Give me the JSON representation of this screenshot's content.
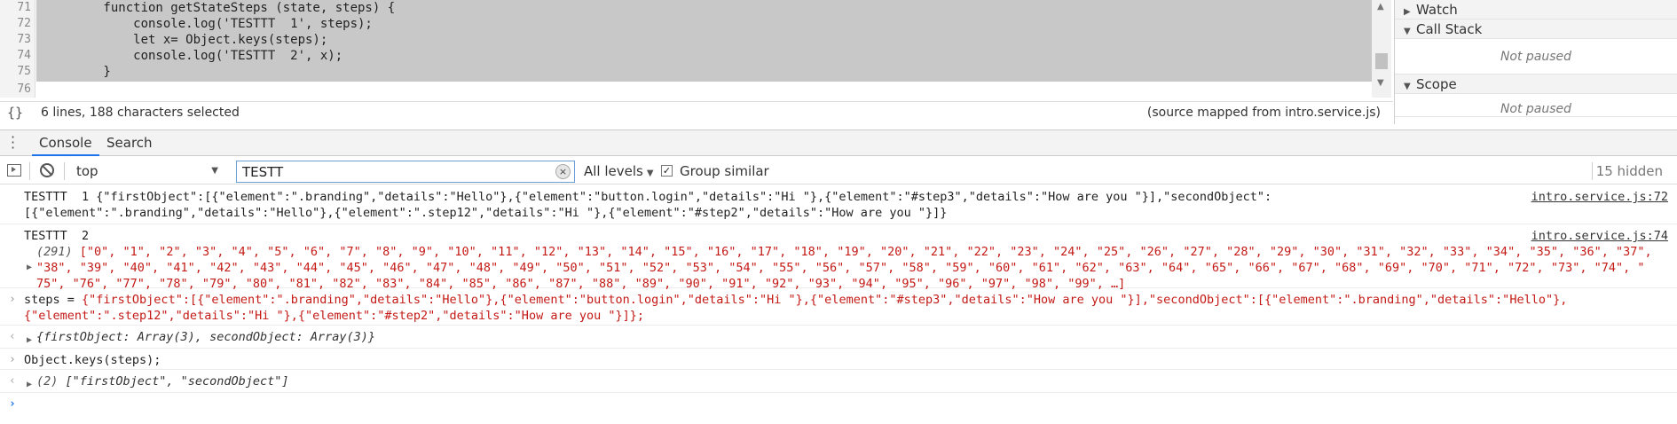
{
  "editor": {
    "lines": [
      {
        "num": "71",
        "text": "        function getStateSteps (state, steps) {"
      },
      {
        "num": "72",
        "text": "            console.log('TESTTT  1', steps);"
      },
      {
        "num": "73",
        "text": "            let x= Object.keys(steps);"
      },
      {
        "num": "74",
        "text": "            console.log('TESTTT  2', x);"
      },
      {
        "num": "75",
        "text": "        }"
      },
      {
        "num": "76",
        "text": ""
      }
    ],
    "status_selection": "6 lines, 188 characters selected",
    "status_source": "(source mapped from intro.service.js)",
    "format_icon": "{}"
  },
  "sidebar": {
    "sections": [
      {
        "label": "Watch",
        "expanded": false
      },
      {
        "label": "Call Stack",
        "expanded": true,
        "empty": "Not paused"
      },
      {
        "label": "Scope",
        "expanded": true,
        "empty": "Not paused"
      }
    ]
  },
  "drawer": {
    "tabs": [
      "Console",
      "Search"
    ],
    "active_tab": "Console"
  },
  "toolbar": {
    "context": "top",
    "filter_value": "TESTT",
    "levels": "All levels",
    "group_similar_label": "Group similar",
    "group_similar_checked": true,
    "hidden": "15 hidden"
  },
  "console": {
    "msg1": {
      "label": "TESTTT  1",
      "line1": " {\"firstObject\":[{\"element\":\".branding\",\"details\":\"Hello\"},{\"element\":\"button.login\",\"details\":\"Hi \"},{\"element\":\"#step3\",\"details\":\"How are you \"}],\"secondObject\":",
      "line2": "[{\"element\":\".branding\",\"details\":\"Hello\"},{\"element\":\".step12\",\"details\":\"Hi \"},{\"element\":\"#step2\",\"details\":\"How are you \"}]}",
      "source": "intro.service.js:72"
    },
    "msg2": {
      "label": "TESTTT  2",
      "source": "intro.service.js:74",
      "count": "(291)",
      "line1": "[\"0\", \"1\", \"2\", \"3\", \"4\", \"5\", \"6\", \"7\", \"8\", \"9\", \"10\", \"11\", \"12\", \"13\", \"14\", \"15\", \"16\", \"17\", \"18\", \"19\", \"20\", \"21\", \"22\", \"23\", \"24\", \"25\", \"26\", \"27\", \"28\", \"29\", \"30\", \"31\", \"32\", \"33\", \"34\", \"35\", \"36\", \"37\",",
      "line2": "\"38\", \"39\", \"40\", \"41\", \"42\", \"43\", \"44\", \"45\", \"46\", \"47\", \"48\", \"49\", \"50\", \"51\", \"52\", \"53\", \"54\", \"55\", \"56\", \"57\", \"58\", \"59\", \"60\", \"61\", \"62\", \"63\", \"64\", \"65\", \"66\", \"67\", \"68\", \"69\", \"70\", \"71\", \"72\", \"73\", \"74\", \"",
      "line3": "75\", \"76\", \"77\", \"78\", \"79\", \"80\", \"81\", \"82\", \"83\", \"84\", \"85\", \"86\", \"87\", \"88\", \"89\", \"90\", \"91\", \"92\", \"93\", \"94\", \"95\", \"96\", \"97\", \"98\", \"99\", …]"
    },
    "cmd1": {
      "line1_prefix": "steps = ",
      "line1": "{\"firstObject\":[{\"element\":\".branding\",\"details\":\"Hello\"},{\"element\":\"button.login\",\"details\":\"Hi \"},{\"element\":\"#step3\",\"details\":\"How are you \"}],\"secondObject\":[{\"element\":\".branding\",\"details\":\"Hello\"},",
      "line2": "{\"element\":\".step12\",\"details\":\"Hi \"},{\"element\":\"#step2\",\"details\":\"How are you \"}]};"
    },
    "res1": "{firstObject: Array(3), secondObject: Array(3)}",
    "cmd2": "Object.keys(steps);",
    "res2_count": "(2)",
    "res2_values": "[\"firstObject\", \"secondObject\"]"
  },
  "colors": {
    "selection_bg": "#c8c8c8",
    "string": "#c41a16",
    "accent": "#1a73e8"
  }
}
